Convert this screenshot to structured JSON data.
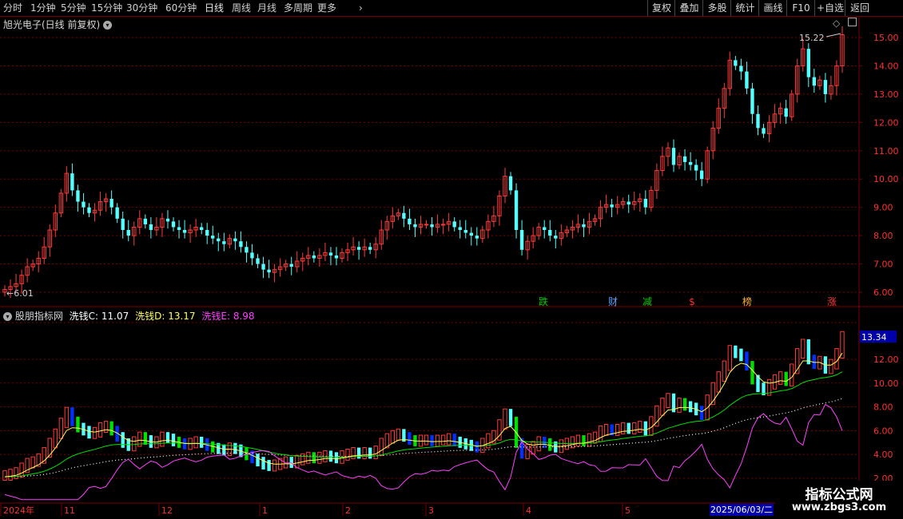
{
  "toolbar": {
    "periods": [
      "分时",
      "1分钟",
      "5分钟",
      "15分钟",
      "30分钟",
      "60分钟",
      "日线",
      "周线",
      "月线",
      "多周期",
      "更多"
    ],
    "active_period": "日线",
    "right_buttons": [
      "复权",
      "叠加",
      "多股",
      "统计",
      "画线",
      "F10",
      "+自选",
      "返回"
    ]
  },
  "main_chart": {
    "stock_title": "旭光电子(日线 前复权)",
    "high_label": "15.22",
    "low_label": "6.01",
    "y_ticks": [
      "15.00",
      "14.00",
      "13.00",
      "12.00",
      "11.00",
      "10.00",
      "9.00",
      "8.00",
      "7.00",
      "6.00"
    ],
    "signal_labels": [
      {
        "text": "跌",
        "color": "#00d000"
      },
      {
        "text": "财",
        "color": "#5aa0ff"
      },
      {
        "text": "减",
        "color": "#00d000"
      },
      {
        "text": "$",
        "color": "#ff3030"
      },
      {
        "text": "榜",
        "color": "#ffb030"
      },
      {
        "text": "涨",
        "color": "#ff3030"
      }
    ]
  },
  "indicator": {
    "name": "股朋指标网",
    "line_c_label": "洗钱C: 11.07",
    "line_d_label": "洗钱D: 13.17",
    "line_e_label": "洗钱E: 8.98",
    "current_value": "13.34",
    "y_ticks": [
      "12.00",
      "10.00",
      "8.00",
      "6.00",
      "4.00",
      "2.00"
    ]
  },
  "x_axis": {
    "labels": [
      "2024年",
      "11",
      "12",
      "1",
      "2",
      "3",
      "4",
      "5"
    ],
    "cursor_date": "2025/06/03/二"
  },
  "watermark": {
    "title": "指标公式网",
    "url": "www.zbgs3.com"
  },
  "colors": {
    "up": "#ff3b3b",
    "down": "#54ffff",
    "grid": "#7a0000",
    "line_c": "#ffffff",
    "line_d": "#ffff60",
    "line_e": "#ff40ff",
    "line_mid": "#00e000"
  },
  "chart_data": {
    "type": "candlestick",
    "y_range": [
      5.8,
      15.5
    ],
    "closes": [
      6.1,
      6.2,
      6.3,
      6.6,
      6.9,
      7.0,
      7.2,
      7.6,
      8.2,
      8.8,
      9.5,
      10.2,
      9.6,
      9.2,
      9.0,
      8.8,
      8.9,
      9.2,
      9.3,
      9.0,
      8.6,
      8.2,
      8.0,
      8.3,
      8.6,
      8.4,
      8.2,
      8.3,
      8.6,
      8.5,
      8.3,
      8.2,
      8.1,
      8.2,
      8.3,
      8.2,
      8.0,
      7.9,
      7.8,
      7.7,
      7.9,
      7.8,
      7.6,
      7.4,
      7.2,
      7.0,
      6.8,
      6.7,
      6.8,
      6.9,
      7.0,
      6.9,
      7.1,
      7.2,
      7.3,
      7.2,
      7.3,
      7.4,
      7.3,
      7.2,
      7.4,
      7.5,
      7.6,
      7.5,
      7.6,
      7.5,
      7.7,
      8.2,
      8.5,
      8.7,
      8.8,
      8.6,
      8.4,
      8.3,
      8.4,
      8.4,
      8.3,
      8.4,
      8.4,
      8.5,
      8.3,
      8.2,
      8.1,
      8.0,
      7.9,
      8.2,
      8.5,
      8.7,
      9.4,
      10.1,
      9.6,
      8.2,
      7.5,
      7.8,
      8.0,
      8.3,
      8.2,
      8.0,
      7.9,
      8.1,
      8.2,
      8.3,
      8.4,
      8.3,
      8.5,
      8.6,
      9.0,
      9.1,
      9.0,
      9.1,
      9.2,
      9.1,
      9.2,
      9.3,
      9.0,
      9.6,
      10.3,
      10.8,
      11.1,
      10.5,
      10.8,
      10.6,
      10.5,
      10.3,
      10.0,
      11.0,
      11.8,
      12.5,
      13.2,
      14.2,
      14.0,
      13.8,
      13.2,
      12.3,
      11.8,
      11.6,
      12.0,
      12.3,
      12.5,
      12.2,
      13.0,
      14.0,
      14.6,
      13.6,
      13.3,
      13.5,
      13.0,
      13.3,
      14.0,
      15.1
    ]
  }
}
